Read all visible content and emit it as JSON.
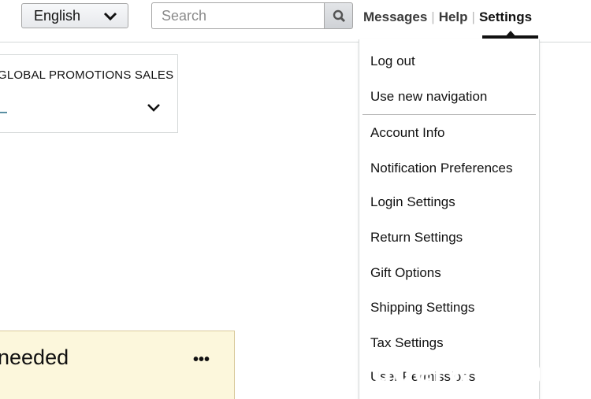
{
  "header": {
    "language_select": {
      "value": "English"
    },
    "search": {
      "placeholder": "Search"
    },
    "links": [
      {
        "label": "Messages"
      },
      {
        "label": "Help"
      },
      {
        "label": "Settings"
      }
    ]
  },
  "promo_card": {
    "label": "GLOBAL PROMOTIONS SALES"
  },
  "alert_card": {
    "text": "needed",
    "more": "•••"
  },
  "settings_menu": {
    "items": [
      {
        "label": "Log out"
      },
      {
        "label": "Use new navigation"
      },
      {
        "label": "Account Info"
      },
      {
        "label": "Notification Preferences"
      },
      {
        "label": "Login Settings"
      },
      {
        "label": "Return Settings"
      },
      {
        "label": "Gift Options"
      },
      {
        "label": "Shipping Settings"
      },
      {
        "label": "Tax Settings"
      },
      {
        "label": "User Permissions"
      }
    ]
  },
  "watermark": {
    "text": "ugerwu.co"
  },
  "colors": {
    "accent_underline": "#111111",
    "alert_background": "#fcf7dc",
    "border": "#d5d9d9"
  }
}
